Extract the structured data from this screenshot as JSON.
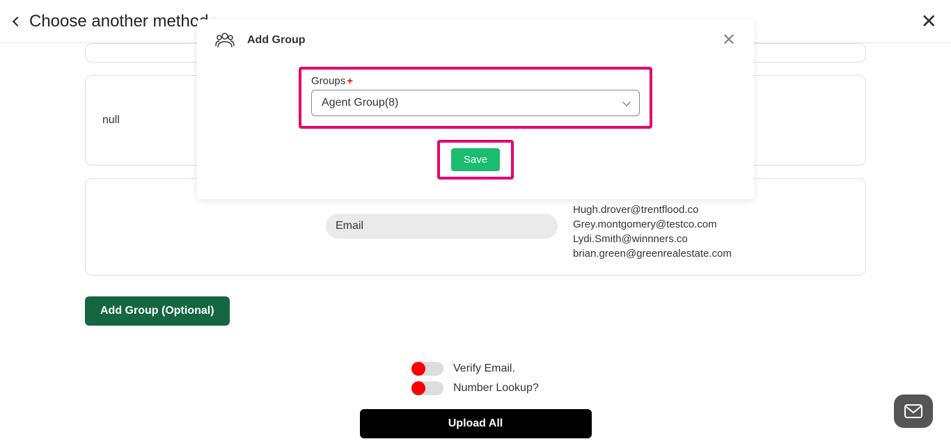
{
  "top": {
    "title": "Choose another method",
    "close": "✕"
  },
  "card_null": "null",
  "email_pill": "Email",
  "emails": [
    "Hugh.drover@trentflood.co",
    "Grey.montgomery@testco.com",
    "Lydi.Smith@winnners.co",
    "brian.green@greenrealestate.com"
  ],
  "add_group_btn": "Add Group (Optional)",
  "toggles": {
    "verify_email": "Verify Email.",
    "number_lookup": "Number Lookup?"
  },
  "upload_btn": "Upload All",
  "modal": {
    "title": "Add Group",
    "close": "✕",
    "groups_label": "Groups",
    "plus": "+",
    "select_value": "Agent Group(8)",
    "save": "Save"
  }
}
